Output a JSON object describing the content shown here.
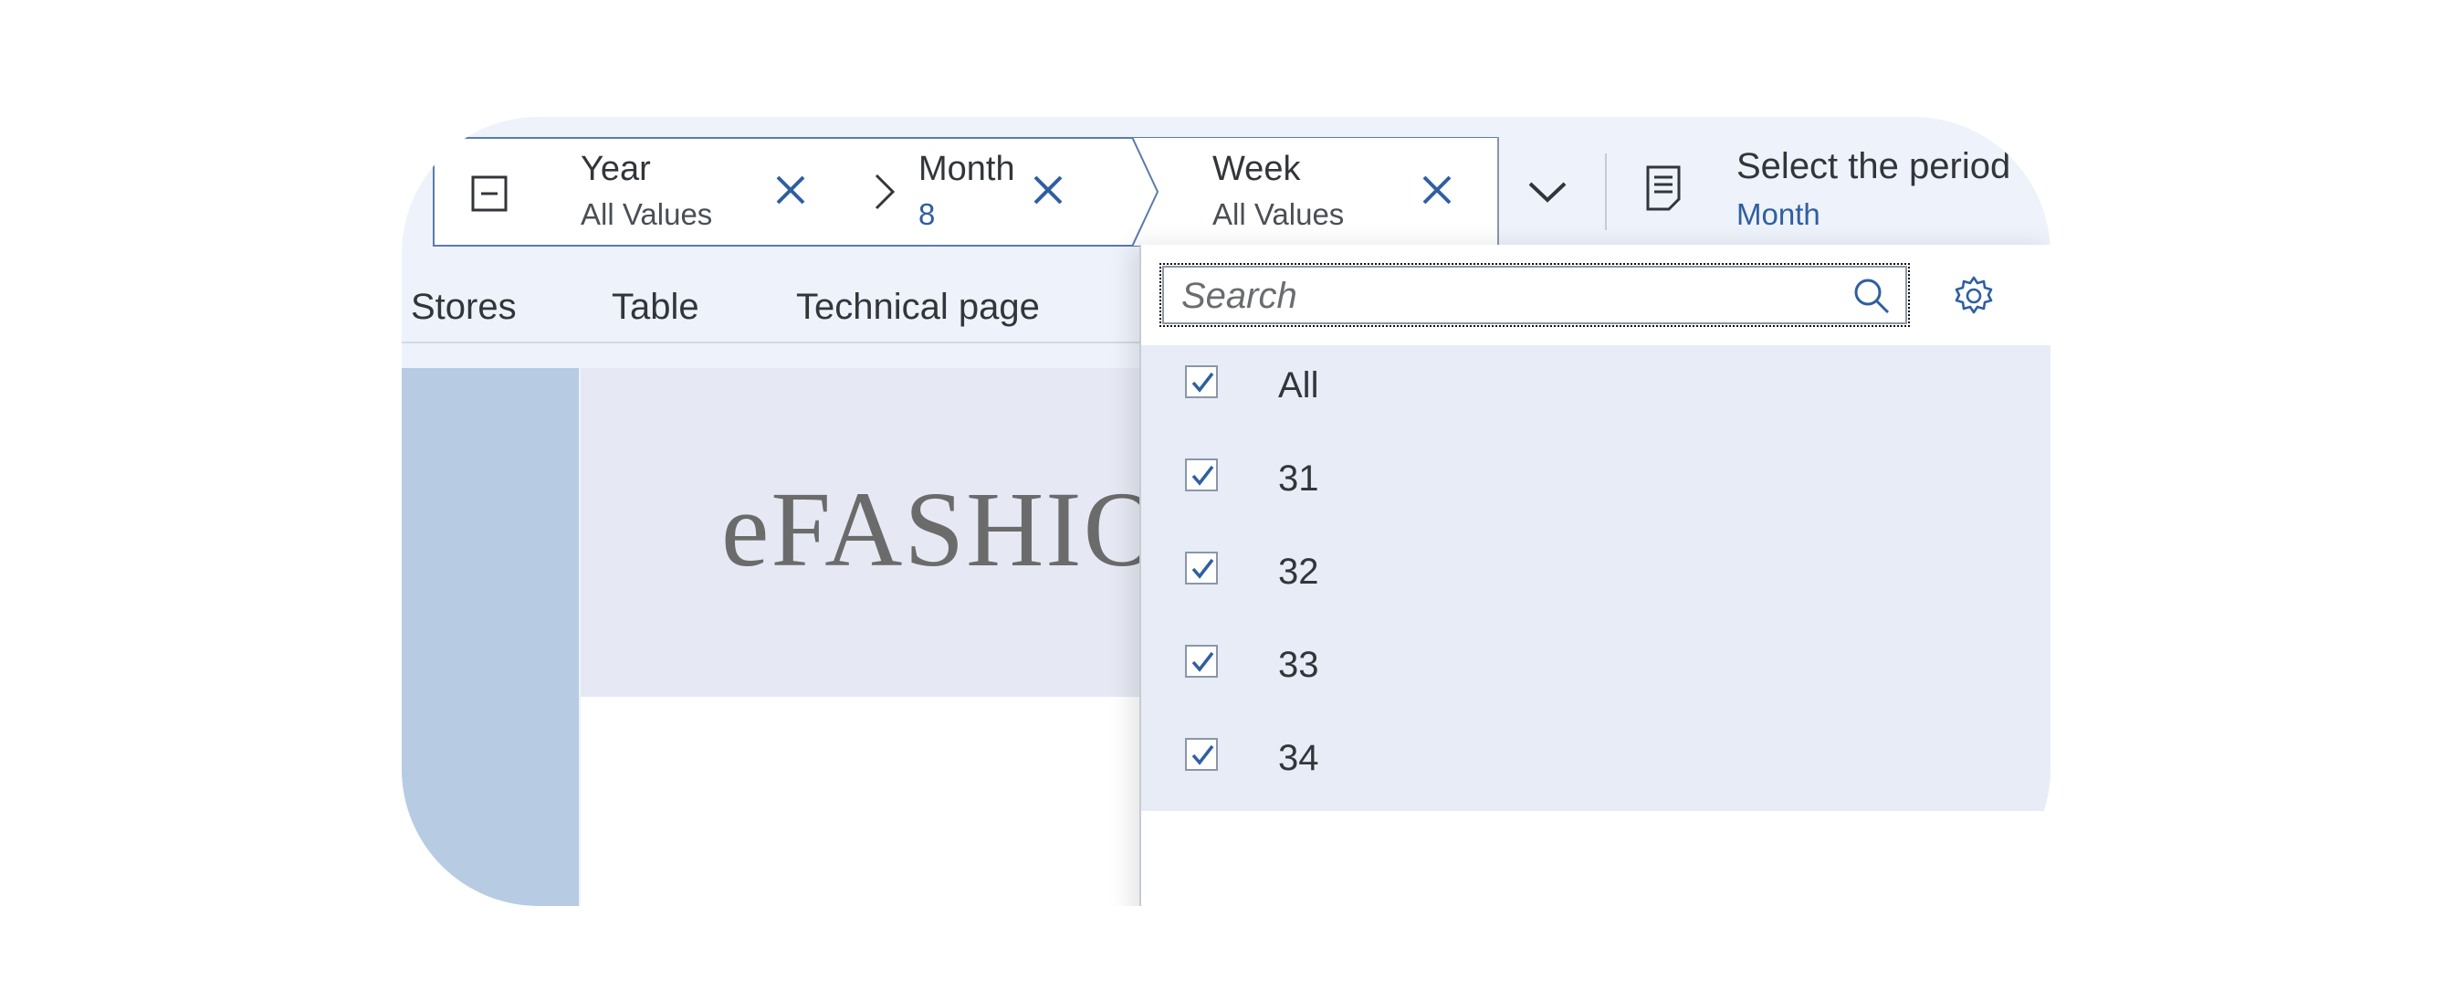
{
  "filters": {
    "year": {
      "title": "Year",
      "value": "All Values"
    },
    "month": {
      "title": "Month",
      "value": "8"
    },
    "week": {
      "title": "Week",
      "value": "All Values"
    },
    "period": {
      "title": "Select the period",
      "value": "Month"
    }
  },
  "tabs": [
    "Stores",
    "Table",
    "Technical page"
  ],
  "logo_text": "eFASHION",
  "dropdown": {
    "search_placeholder": "Search",
    "items": [
      {
        "label": "All",
        "checked": true
      },
      {
        "label": "31",
        "checked": true
      },
      {
        "label": "32",
        "checked": true
      },
      {
        "label": "33",
        "checked": true
      },
      {
        "label": "34",
        "checked": true
      }
    ]
  },
  "colors": {
    "accent": "#2f5fa0",
    "selected_bg": "#e7ecf7",
    "side_panel": "#b7cbe3",
    "logo_banner": "#e6e9f3"
  }
}
